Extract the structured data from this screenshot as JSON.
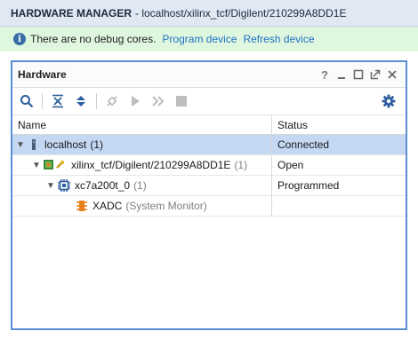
{
  "window": {
    "title": "HARDWARE MANAGER",
    "subtitle": "- localhost/xilinx_tcf/Digilent/210299A8DD1E"
  },
  "banner": {
    "message": "There are no debug cores.",
    "link_program": "Program device",
    "link_refresh": "Refresh device",
    "icon": "info-icon"
  },
  "panel": {
    "title": "Hardware",
    "header_buttons": [
      "help-icon",
      "minimize-icon",
      "maximize-icon",
      "float-icon",
      "close-icon"
    ],
    "toolbar": [
      "search-icon",
      "collapse-all-icon",
      "expand-all-icon",
      "auto-connect-icon",
      "run-trigger-icon",
      "run-immediate-icon",
      "stop-trigger-icon",
      "settings-icon"
    ]
  },
  "table": {
    "columns": [
      "Name",
      "Status"
    ],
    "rows": [
      {
        "name": "localhost",
        "suffix": "(1)",
        "status": "Connected",
        "icon": "server-icon"
      },
      {
        "name": "xilinx_tcf/Digilent/210299A8DD1E",
        "suffix": "(1)",
        "status": "Open",
        "icon": "jtag-cable-icon"
      },
      {
        "name": "xc7a200t_0",
        "suffix": "(1)",
        "status": "Programmed",
        "icon": "fpga-chip-icon"
      },
      {
        "name": "XADC",
        "suffix": "(System Monitor)",
        "status": "",
        "icon": "xadc-icon"
      }
    ]
  },
  "colors": {
    "accent": "#5a8fd6",
    "selected_row": "#c4d7f3",
    "banner_bg": "#dff6df",
    "link": "#1f72c4"
  }
}
